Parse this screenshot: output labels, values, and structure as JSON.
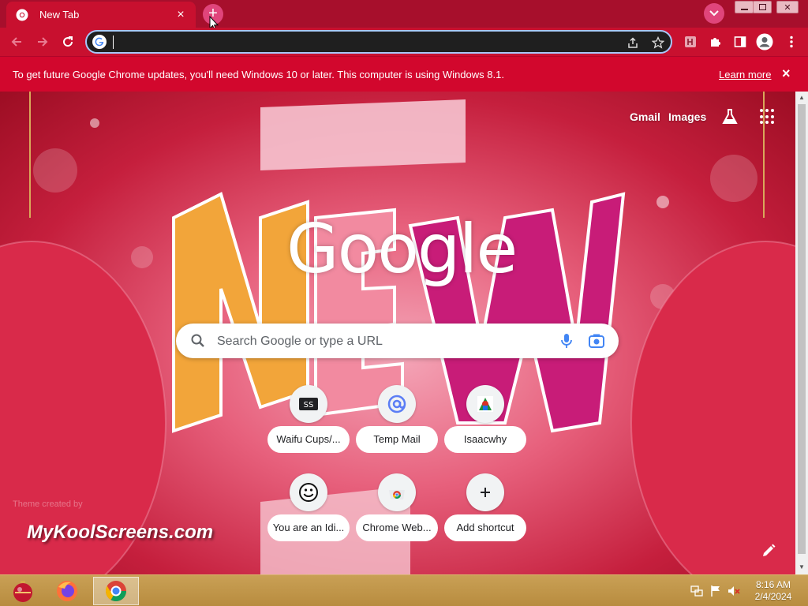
{
  "browser": {
    "tab_title": "New Tab",
    "tab_close": "×",
    "new_tab_symbol": "+"
  },
  "infobar": {
    "message": "To get future Google Chrome updates, you'll need Windows 10 or later. This computer is using Windows 8.1.",
    "learn_more": "Learn more",
    "dismiss": "×"
  },
  "omnibox": {
    "value": ""
  },
  "ntp": {
    "links": {
      "gmail": "Gmail",
      "images": "Images"
    },
    "logo_text": "Google",
    "search_placeholder": "Search Google or type a URL",
    "shortcuts": [
      {
        "label": "Waifu Cups/...",
        "icon": "waifu-cups-icon"
      },
      {
        "label": "Temp Mail",
        "icon": "temp-mail-icon"
      },
      {
        "label": "Isaacwhy",
        "icon": "isaacwhy-icon"
      },
      {
        "label": "You are an Idi...",
        "icon": "smiley-icon"
      },
      {
        "label": "Chrome Web...",
        "icon": "chrome-web-store-icon"
      },
      {
        "label": "Add shortcut",
        "icon": "plus-icon"
      }
    ],
    "watermark": "MyKoolScreens.com",
    "theme_credit": "Theme created by"
  },
  "taskbar": {
    "time": "8:16 AM",
    "date": "2/4/2024"
  },
  "colors": {
    "accent": "#c8102f",
    "titlebar": "#a70f2c",
    "taskbar": "#c9a055"
  }
}
